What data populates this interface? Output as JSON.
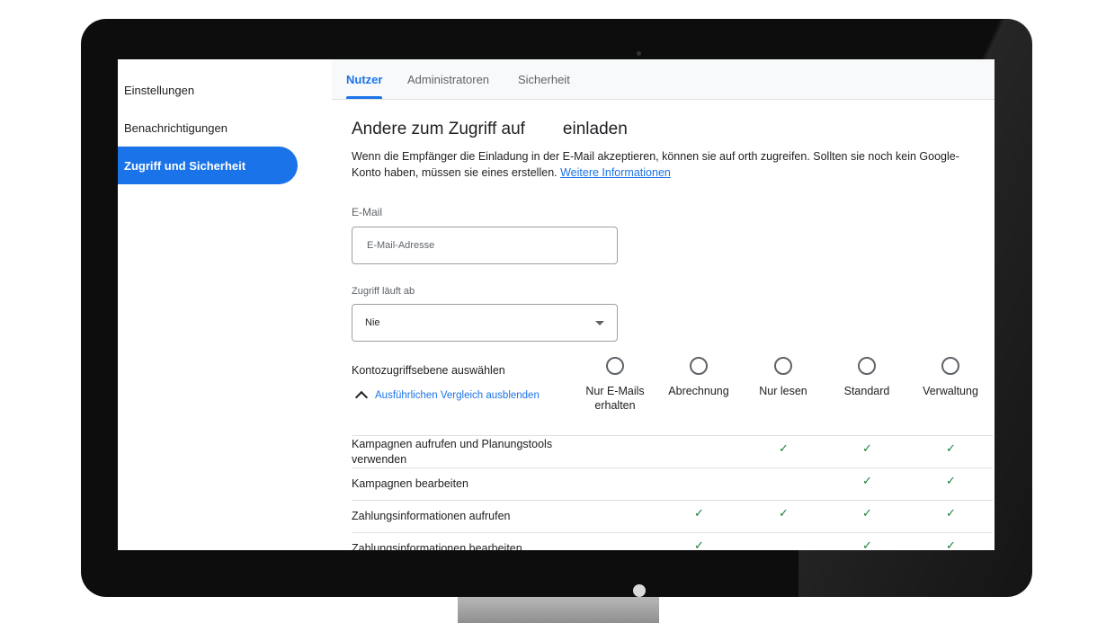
{
  "sidebar": {
    "items": [
      {
        "label": "Einstellungen"
      },
      {
        "label": "Benachrichtigungen"
      },
      {
        "label": "Zugriff und Sicherheit",
        "active": true
      }
    ]
  },
  "tabs": [
    {
      "label": "Nutzer",
      "active": true
    },
    {
      "label": "Administratoren"
    },
    {
      "label": "Sicherheit"
    }
  ],
  "panel": {
    "title_part1": "Andere zum Zugriff auf",
    "title_part2": "einladen",
    "description": "Wenn die Empfänger die Einladung in der E-Mail akzeptieren, können sie auf orth zugreifen. Sollten sie noch kein Google-Konto haben, müssen sie eines erstellen. ",
    "more_info_link": "Weitere Informationen",
    "email": {
      "label": "E-Mail",
      "placeholder": "E-Mail-Adresse"
    },
    "expiry": {
      "label": "Zugriff läuft ab",
      "value": "Nie"
    },
    "access_level_label": "Kontozugriffsebene auswählen",
    "toggle_compare": "Ausführlichen Vergleich ausblenden",
    "roles": [
      {
        "line1": "Nur E-Mails",
        "line2": "erhalten"
      },
      {
        "line1": "Abrechnung",
        "line2": ""
      },
      {
        "line1": "Nur lesen",
        "line2": ""
      },
      {
        "line1": "Standard",
        "line2": ""
      },
      {
        "line1": "Verwaltung",
        "line2": ""
      }
    ],
    "check_glyph": "✓",
    "permissions": [
      {
        "label": "Kampagnen aufrufen und Planungstools verwenden",
        "checks": [
          false,
          false,
          true,
          true,
          true
        ]
      },
      {
        "label": "Kampagnen bearbeiten",
        "checks": [
          false,
          false,
          false,
          true,
          true
        ]
      },
      {
        "label": "Zahlungsinformationen aufrufen",
        "checks": [
          false,
          true,
          true,
          true,
          true
        ]
      },
      {
        "label": "Zahlungsinformationen bearbeiten",
        "checks": [
          false,
          true,
          false,
          true,
          true
        ]
      }
    ]
  },
  "colors": {
    "accent": "#1a73e8",
    "check": "#188038",
    "bezel": "#0d0d0d"
  }
}
